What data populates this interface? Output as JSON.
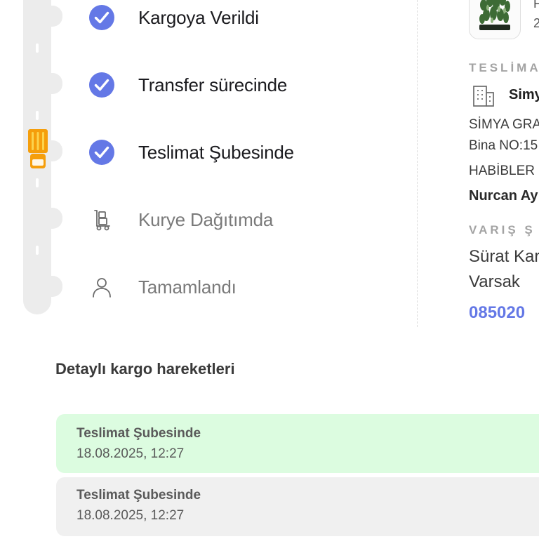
{
  "colors": {
    "accent": "#6478e6",
    "truck": "#f59e0b",
    "active_move_bg": "#dcfce0",
    "inactive_move_bg": "#f0f0f0"
  },
  "tracking": {
    "steps": [
      {
        "label": "Kargoya Verildi",
        "icon": "check-circle-icon",
        "state": "done"
      },
      {
        "label": "Transfer sürecinde",
        "icon": "check-circle-icon",
        "state": "done"
      },
      {
        "label": "Teslimat Şubesinde",
        "icon": "check-circle-icon",
        "state": "done"
      },
      {
        "label": "Kurye Dağıtımda",
        "icon": "courier-dolly-icon",
        "state": "pending"
      },
      {
        "label": "Tamamlandı",
        "icon": "person-icon",
        "state": "pending"
      }
    ],
    "current_step_icon": "truck-icon"
  },
  "product": {
    "thumbnail_icon": "plant-icon",
    "text_top": "F",
    "text_bottom": "2"
  },
  "delivery": {
    "section_title": "TESLİMA",
    "recipient_icon": "building-icon",
    "recipient_name": "Simy",
    "address_line1": "SİMYA GRA",
    "address_line2": "Bina NO:15",
    "district": "HABİBLER",
    "contact_name": "Nurcan Ay"
  },
  "arrival_branch": {
    "section_title": "VARIŞ Ş",
    "name_line1": "Sürat Kar",
    "name_line2": "Varsak",
    "phone": "085020"
  },
  "movements": {
    "title": "Detaylı kargo hareketleri",
    "items": [
      {
        "status": "Teslimat Şubesinde",
        "datetime": "18.08.2025, 12:27",
        "active": true
      },
      {
        "status": "Teslimat Şubesinde",
        "datetime": "18.08.2025, 12:27",
        "active": false
      }
    ]
  }
}
